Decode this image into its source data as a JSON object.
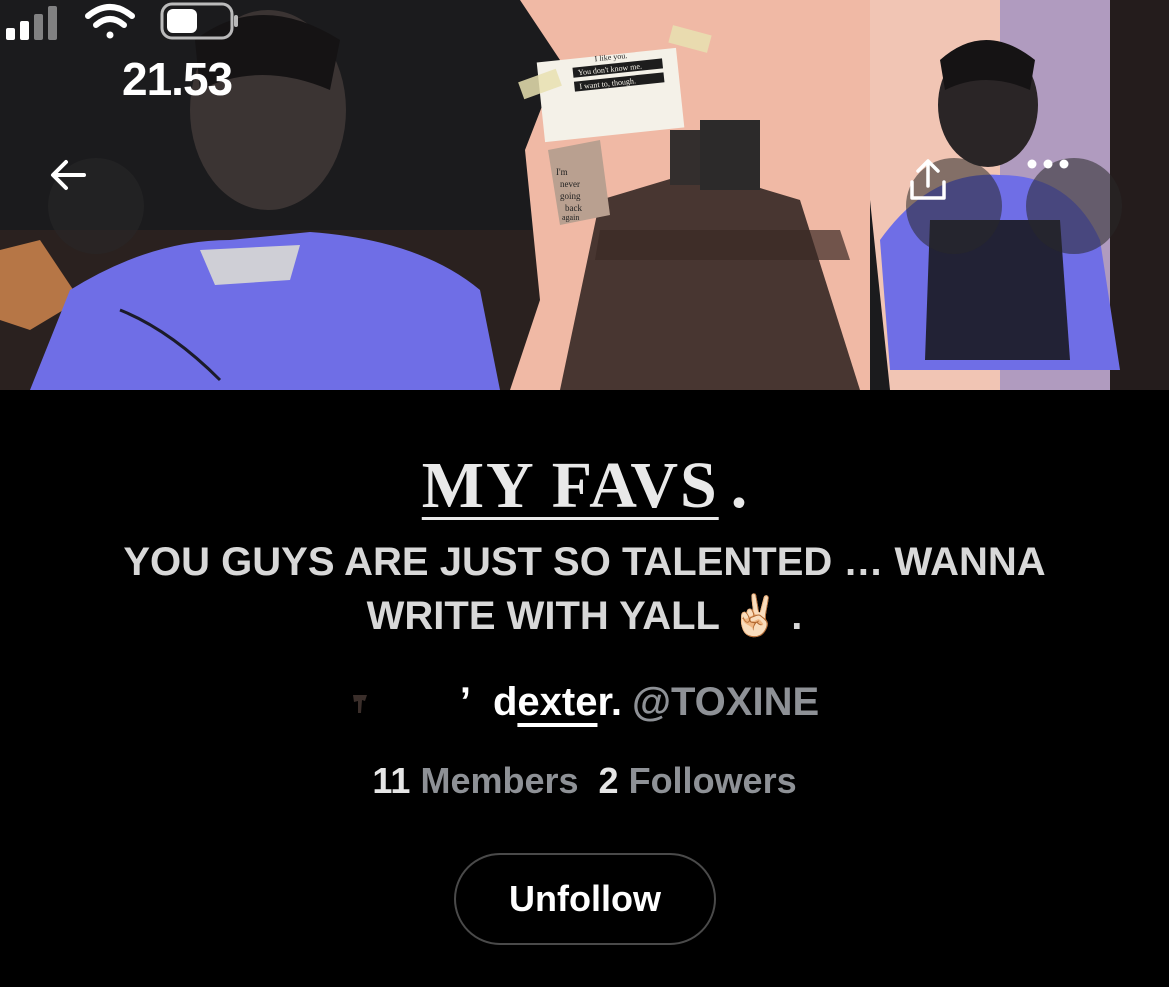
{
  "status_bar": {
    "time": "21.53"
  },
  "banner": {
    "note_lines": [
      "I like you.",
      "You don't know me.",
      "I want to, though."
    ],
    "scrap_text": [
      "I'm",
      "never",
      "going",
      "back",
      "again"
    ]
  },
  "list": {
    "title": "MY FAVS",
    "title_suffix": ".",
    "description_line1": "YOU GUYS ARE JUST SO TALENTED … WANNA",
    "description_line2": "WRITE WITH YALL ✌🏻 ."
  },
  "owner": {
    "apostrophe": "’",
    "name_prefix": "d",
    "name_underlined": "exte",
    "name_suffix": "r.",
    "handle": "@TOXINE"
  },
  "stats": {
    "members_count": "11",
    "members_label": "Members",
    "followers_count": "2",
    "followers_label": "Followers"
  },
  "actions": {
    "unfollow_label": "Unfollow"
  },
  "colors": {
    "background": "#000000",
    "muted_text": "#8e9196",
    "banner_blue": "#6f6ee6",
    "banner_peach": "#f0b9a5"
  }
}
